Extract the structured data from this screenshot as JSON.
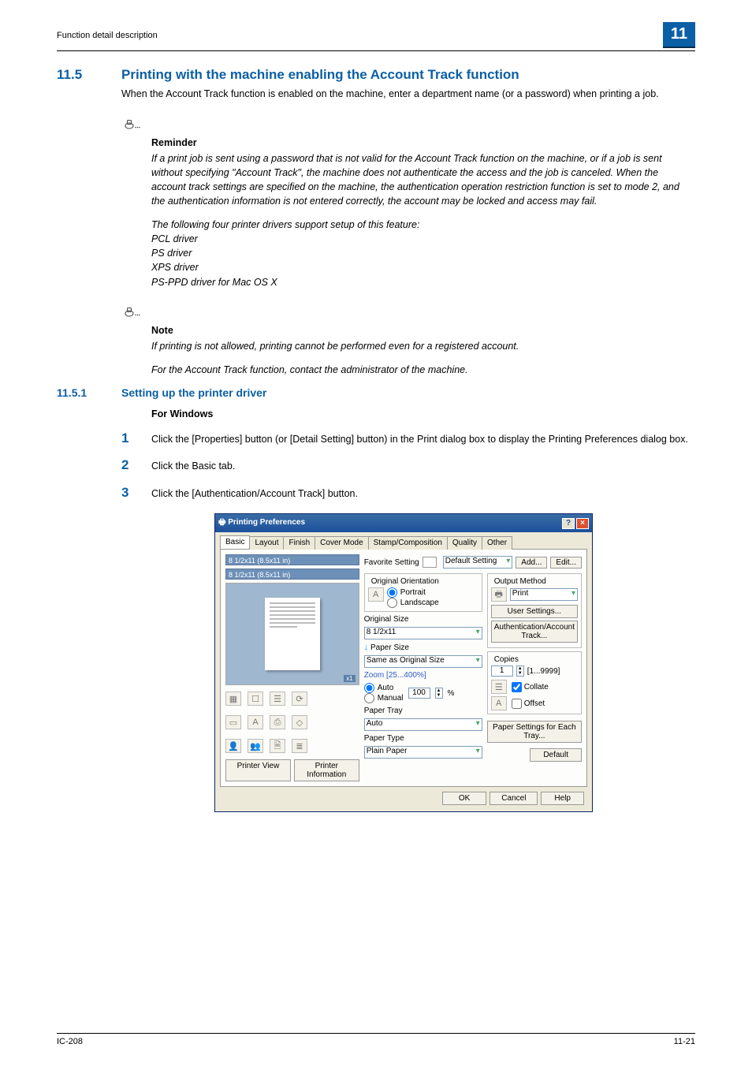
{
  "header": {
    "left": "Function detail description",
    "badge": "11"
  },
  "section": {
    "number": "11.5",
    "title": "Printing with the machine enabling the Account Track function",
    "intro": "When the Account Track function is enabled on the machine, enter a department name (or a password) when printing a job."
  },
  "reminder": {
    "label": "Reminder",
    "p1": "If a print job is sent using a password that is not valid for the Account Track function on the machine, or if a job is sent without specifying \"Account Track\", the machine does not authenticate the access and the job is canceled. When the account track settings are specified on the machine, the authentication operation restriction function is set to mode 2, and the authentication information is not entered correctly, the account may be locked and access may fail.",
    "p2": "The following four printer drivers support setup of this feature:",
    "drivers": [
      "PCL driver",
      "PS driver",
      "XPS driver",
      "PS-PPD driver for Mac OS X"
    ]
  },
  "note": {
    "label": "Note",
    "p1": "If printing is not allowed, printing cannot be performed even for a registered account.",
    "p2": "For the Account Track function, contact the administrator of the machine."
  },
  "subsection": {
    "number": "11.5.1",
    "title": "Setting up the printer driver",
    "heading": "For Windows"
  },
  "steps": [
    {
      "num": "1",
      "text": "Click the [Properties] button (or [Detail Setting] button) in the Print dialog box to display the Printing Preferences dialog box."
    },
    {
      "num": "2",
      "text": "Click the Basic tab."
    },
    {
      "num": "3",
      "text": "Click the [Authentication/Account Track] button."
    }
  ],
  "dialog": {
    "title": "Printing Preferences",
    "tabs": [
      "Basic",
      "Layout",
      "Finish",
      "Cover Mode",
      "Stamp/Composition",
      "Quality",
      "Other"
    ],
    "preview": {
      "size1": "8 1/2x11 (8.5x11 in)",
      "size2": "8 1/2x11 (8.5x11 in)",
      "badge": "x1"
    },
    "left_buttons": {
      "printer_view": "Printer View",
      "printer_info": "Printer Information"
    },
    "favorite": {
      "label": "Favorite Setting",
      "value": "Default Setting",
      "add": "Add...",
      "edit": "Edit..."
    },
    "orientation": {
      "legend": "Original Orientation",
      "portrait": "Portrait",
      "landscape": "Landscape"
    },
    "orig_size": {
      "label": "Original Size",
      "value": "8 1/2x11"
    },
    "paper_size": {
      "label": "Paper Size",
      "value": "Same as Original Size"
    },
    "zoom": {
      "label": "Zoom [25...400%]",
      "auto": "Auto",
      "manual": "Manual",
      "value": "100",
      "pct": "%"
    },
    "paper_tray": {
      "label": "Paper Tray",
      "value": "Auto"
    },
    "paper_type": {
      "label": "Paper Type",
      "value": "Plain Paper"
    },
    "output": {
      "legend": "Output Method",
      "value": "Print",
      "user_settings": "User Settings...",
      "auth": "Authentication/Account Track..."
    },
    "copies": {
      "legend": "Copies",
      "value": "1",
      "range": "[1...9999]",
      "collate": "Collate",
      "offset": "Offset"
    },
    "paper_each_tray": "Paper Settings for Each Tray...",
    "default_btn": "Default",
    "ok": "OK",
    "cancel": "Cancel",
    "help": "Help"
  },
  "footer": {
    "left": "IC-208",
    "right": "11-21"
  }
}
